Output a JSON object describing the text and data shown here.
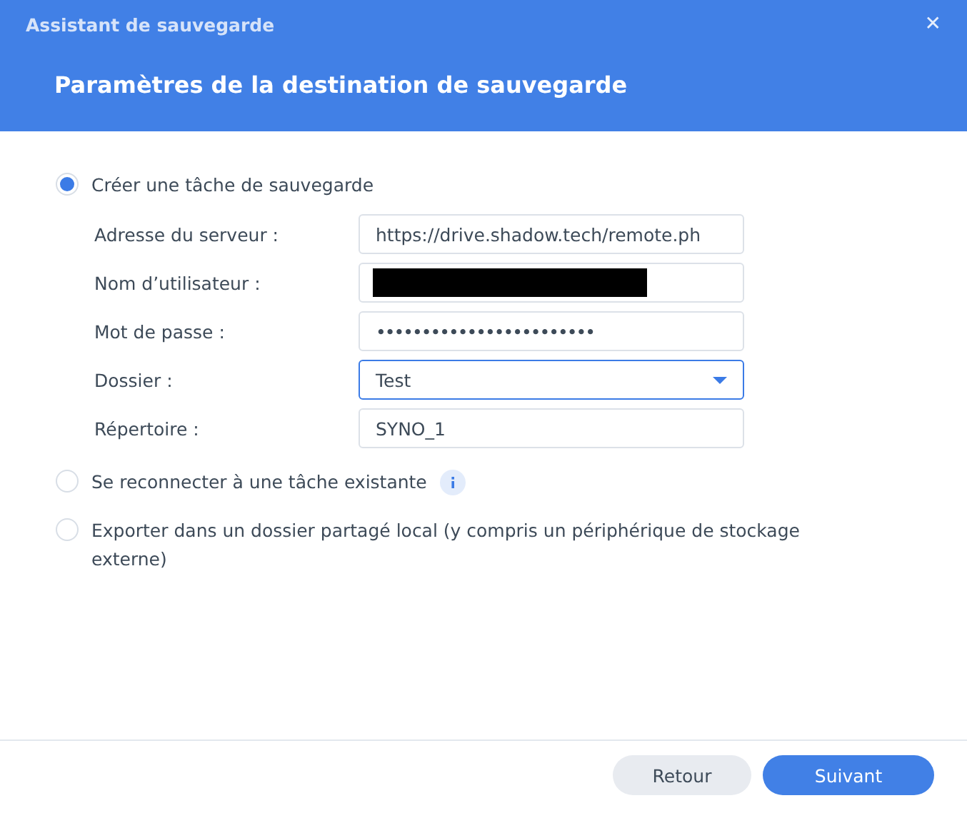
{
  "window": {
    "title": "Assistant de sauvegarde",
    "close": "✕"
  },
  "heading": "Paramètres de la destination de sauvegarde",
  "options": [
    {
      "label": "Créer une tâche de sauvegarde",
      "selected": true,
      "info": false,
      "fields": [
        {
          "label": "Adresse du serveur :",
          "kind": "text",
          "value": "https://drive.shadow.tech/remote.ph",
          "focused": false
        },
        {
          "label": "Nom d’utilisateur :",
          "kind": "redacted",
          "focused": false
        },
        {
          "label": "Mot de passe :",
          "kind": "password",
          "value": "••••••••••••••••••••••••",
          "focused": false
        },
        {
          "label": "Dossier :",
          "kind": "select",
          "value": "Test",
          "focused": true
        },
        {
          "label": "Répertoire :",
          "kind": "text",
          "value": "SYNO_1",
          "focused": false
        }
      ]
    },
    {
      "label": "Se reconnecter à une tâche existante",
      "selected": false,
      "info": true
    },
    {
      "label": "Exporter dans un dossier partagé local (y compris un périphérique de stockage externe)",
      "selected": false,
      "info": false
    }
  ],
  "buttons": [
    {
      "label": "Retour",
      "kind": "secondary"
    },
    {
      "label": "Suivant",
      "kind": "primary"
    }
  ]
}
